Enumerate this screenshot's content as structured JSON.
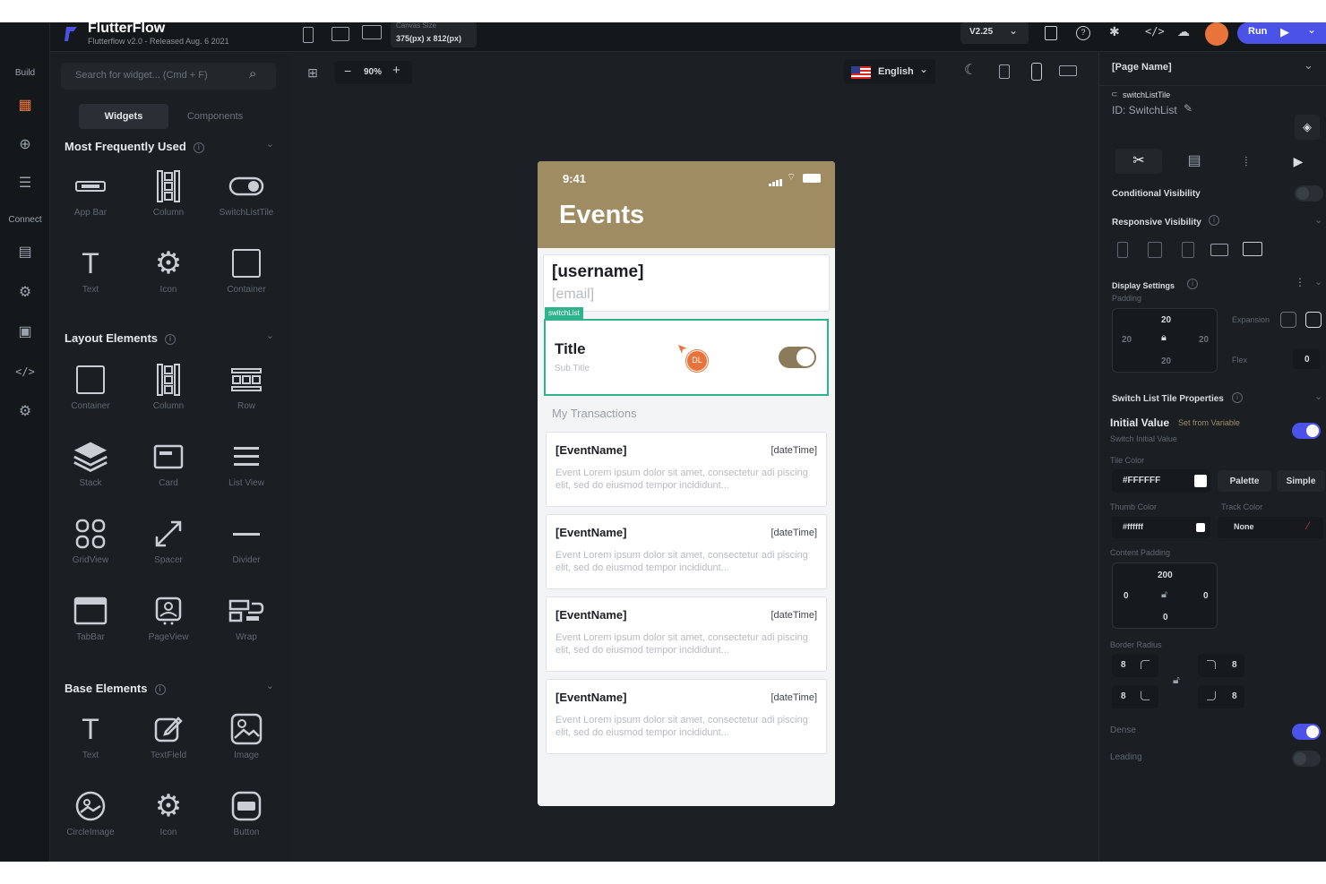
{
  "app": {
    "name": "FlutterFlow",
    "version_line": "Flutterflow v2.0 - Released Aug. 6 2021",
    "canvas_size_label": "Canvas Size",
    "canvas_size_value": "375(px) x 812(px)",
    "version_badge": "V2.25",
    "run_label": "Run"
  },
  "rail": {
    "build_label": "Build",
    "connect_label": "Connect"
  },
  "left_panel": {
    "search_placeholder": "Search for widget... (Cmd + F)",
    "tabs": [
      "Widgets",
      "Components"
    ],
    "sections": [
      {
        "title": "Most Frequently Used",
        "items": [
          "App Bar",
          "Column",
          "SwitchListTile",
          "Text",
          "Icon",
          "Container"
        ]
      },
      {
        "title": "Layout Elements",
        "items": [
          "Container",
          "Column",
          "Row",
          "Stack",
          "Card",
          "List View",
          "GridView",
          "Spacer",
          "Divider",
          "TabBar",
          "PageView",
          "Wrap"
        ]
      },
      {
        "title": "Base Elements",
        "items": [
          "Text",
          "TextField",
          "Image",
          "CircleImage",
          "Icon",
          "Button"
        ]
      }
    ]
  },
  "canvas_toolbar": {
    "zoom": "90%",
    "language": "English"
  },
  "phone": {
    "time": "9:41",
    "title": "Events",
    "username": "[username]",
    "email": "[email]",
    "switch_tag": "switchList",
    "tile_title": "Title",
    "tile_subtitle": "Sub Title",
    "avatar_initials": "DL",
    "section_label": "My Transactions",
    "events": [
      {
        "name": "[EventName]",
        "time": "[dateTime]",
        "desc": "Event Lorem ipsum dolor sit amet, consectetur adi piscing elit, sed do eiusmod tempor incididunt..."
      },
      {
        "name": "[EventName]",
        "time": "[dateTime]",
        "desc": "Event Lorem ipsum dolor sit amet, consectetur adi piscing elit, sed do eiusmod tempor incididunt..."
      },
      {
        "name": "[EventName]",
        "time": "[dateTime]",
        "desc": "Event Lorem ipsum dolor sit amet, consectetur adi piscing elit, sed do eiusmod tempor incididunt..."
      },
      {
        "name": "[EventName]",
        "time": "[dateTime]",
        "desc": "Event Lorem ipsum dolor sit amet, consectetur adi piscing elit, sed do eiusmod tempor incididunt..."
      }
    ]
  },
  "right_panel": {
    "page_name": "[Page Name]",
    "widget_type": "switchListTile",
    "widget_id": "ID: SwitchList",
    "conditional_visibility": "Conditional Visibility",
    "responsive_visibility": "Responsive Visibility",
    "display_settings": "Display Settings",
    "padding_label": "Padding",
    "padding": {
      "top": "20",
      "left": "20",
      "right": "20",
      "bottom": "20"
    },
    "expansion_label": "Expansion",
    "flex_label": "Flex",
    "flex_value": "0",
    "switch_props": "Switch List Tile Properties",
    "initial_value": "Initial Value",
    "set_from_variable": "Set from Variable",
    "switch_initial_value": "Switch Initial Value",
    "tile_color_label": "Tile Color",
    "tile_color": "#FFFFFF",
    "palette": "Palette",
    "simple": "Simple",
    "thumb_color_label": "Thumb Color",
    "thumb_color": "#ffffff",
    "track_color_label": "Track Color",
    "track_color": "None",
    "content_padding": "Content Padding",
    "content_padding_values": {
      "top": "200",
      "left": "0",
      "right": "0",
      "bottom": "0"
    },
    "border_radius": "Border Radius",
    "radius_values": [
      "8",
      "8",
      "8",
      "8"
    ],
    "dense": "Dense",
    "leading": "Leading"
  },
  "colors": {
    "accent": "#4b52e8",
    "brand_header": "#a08c63",
    "switch_selection": "#2fb38c",
    "avatar": "#e8743b"
  }
}
